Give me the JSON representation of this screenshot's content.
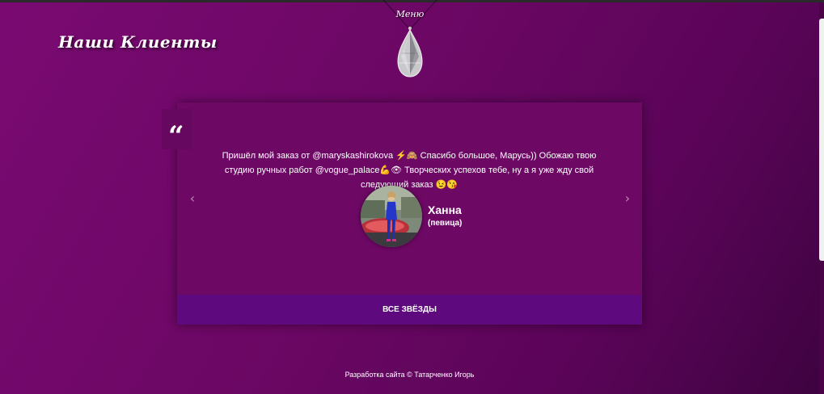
{
  "site": {
    "title": "Наши Клиенты",
    "menu_label": "Меню"
  },
  "testimonial": {
    "quote_glyph": "“",
    "text": "Пришёл мой заказ от @maryskashirokova ⚡🙈 Спасибо большое, Марусь)) Обожаю твою студию ручных работ @vogue_palace💪👁 Творческих успехов тебе, ну а я уже жду свой следующий заказ 😉😘",
    "author_name": "Ханна",
    "author_role": "(певица)",
    "prev_glyph": "‹",
    "next_glyph": "›"
  },
  "cta": {
    "all_stars_label": "ВСЕ ЗВЁЗДЫ"
  },
  "footer": {
    "credit": "Разработка сайта © Татарченко Игорь"
  },
  "colors": {
    "background": "#6b0764",
    "card": "#6e0865",
    "button": "#5e0a7e",
    "text": "#ffffff"
  },
  "icons": {
    "menu": "crystal-pendant-icon",
    "quote": "quote-icon",
    "prev": "chevron-left-icon",
    "next": "chevron-right-icon"
  }
}
